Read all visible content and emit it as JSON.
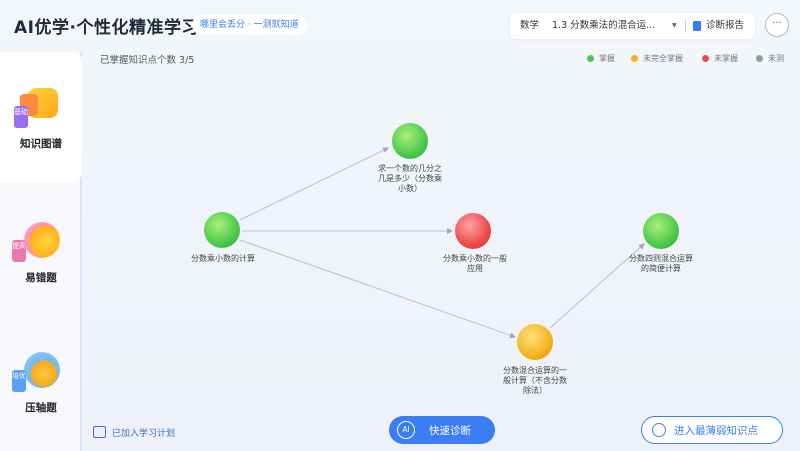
{
  "header": {
    "title": "AI优学·个性化精准学习",
    "slogan": "哪里会丢分 · 一测就知道",
    "subject": "数学",
    "topic": "1.3 分数乘法的混合运...",
    "report": "诊断报告",
    "more": "···"
  },
  "sidebar": {
    "items": [
      {
        "label": "知识图谱",
        "tag": "基础",
        "active": true
      },
      {
        "label": "易错题",
        "tag": "提高",
        "active": false
      },
      {
        "label": "压轴题",
        "tag": "培优",
        "active": false
      }
    ]
  },
  "main": {
    "mastered": "已掌握知识点个数  3/5",
    "legend": [
      {
        "label": "掌握",
        "color": "#4cc94c"
      },
      {
        "label": "未完全掌握",
        "color": "#f2b320"
      },
      {
        "label": "未掌握",
        "color": "#ea4b4b"
      },
      {
        "label": "未测",
        "color": "#999999"
      }
    ],
    "nodes": [
      {
        "label": "分数乘小数的计算",
        "status": "掌握"
      },
      {
        "label": "求一个数的几分之几是多少（分数乘小数）",
        "status": "掌握"
      },
      {
        "label": "分数乘小数的一般应用",
        "status": "未掌握"
      },
      {
        "label": "分数四则混合运算的简便计算",
        "status": "掌握"
      },
      {
        "label": "分数混合运算的一般计算（不含分数除法）",
        "status": "未完全掌握"
      }
    ]
  },
  "footer": {
    "plan": "已加入学习计划",
    "quick_ai": "AI",
    "quick": "快速诊断",
    "enter": "进入最薄弱知识点"
  },
  "colors": {
    "accent": "#3b7df5",
    "mastered": "#4cc94c",
    "partial": "#f2b320",
    "unmastered": "#ea4b4b"
  }
}
